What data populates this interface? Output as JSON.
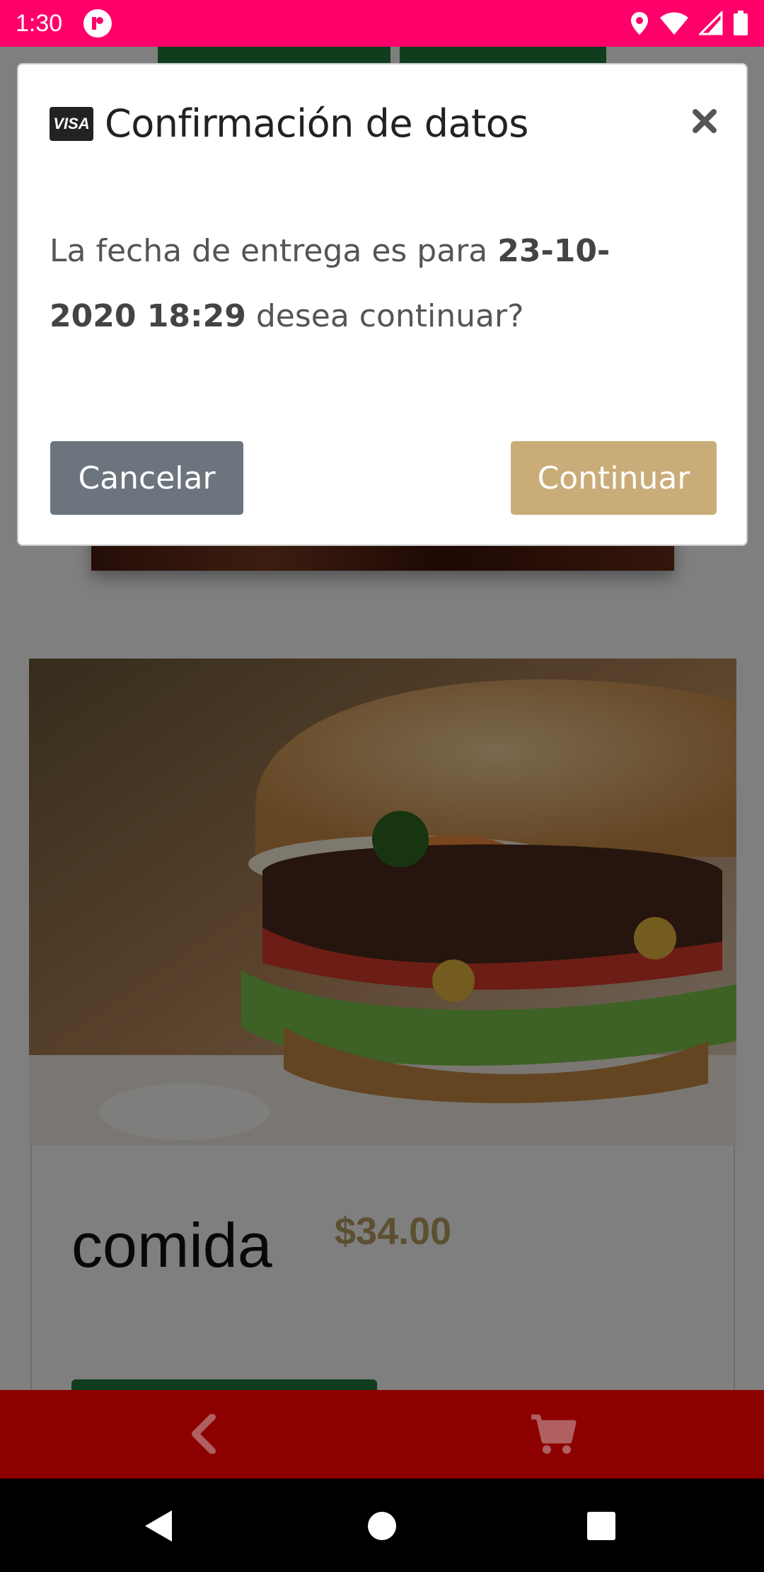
{
  "status_bar": {
    "time": "1:30"
  },
  "modal": {
    "title": "Confirmación de datos",
    "title_icon": "visa-card-icon",
    "visa_label": "VISA",
    "message_prefix": "La fecha de entrega es para ",
    "delivery_date": "23-10-2020 18:29",
    "message_suffix": " desea continuar?",
    "cancel_label": "Cancelar",
    "continue_label": "Continuar"
  },
  "product": {
    "name": "comida",
    "price": "$34.00"
  },
  "bottom_nav": {
    "back_icon": "chevron-left-icon",
    "cart_icon": "shopping-cart-icon"
  },
  "colors": {
    "status_bar": "#ff006b",
    "bottom_bar": "#8d0000",
    "cancel_button": "#6c757d",
    "continue_button": "#c9ac78",
    "price": "#b8a063",
    "green_button": "#1e7a3a"
  }
}
